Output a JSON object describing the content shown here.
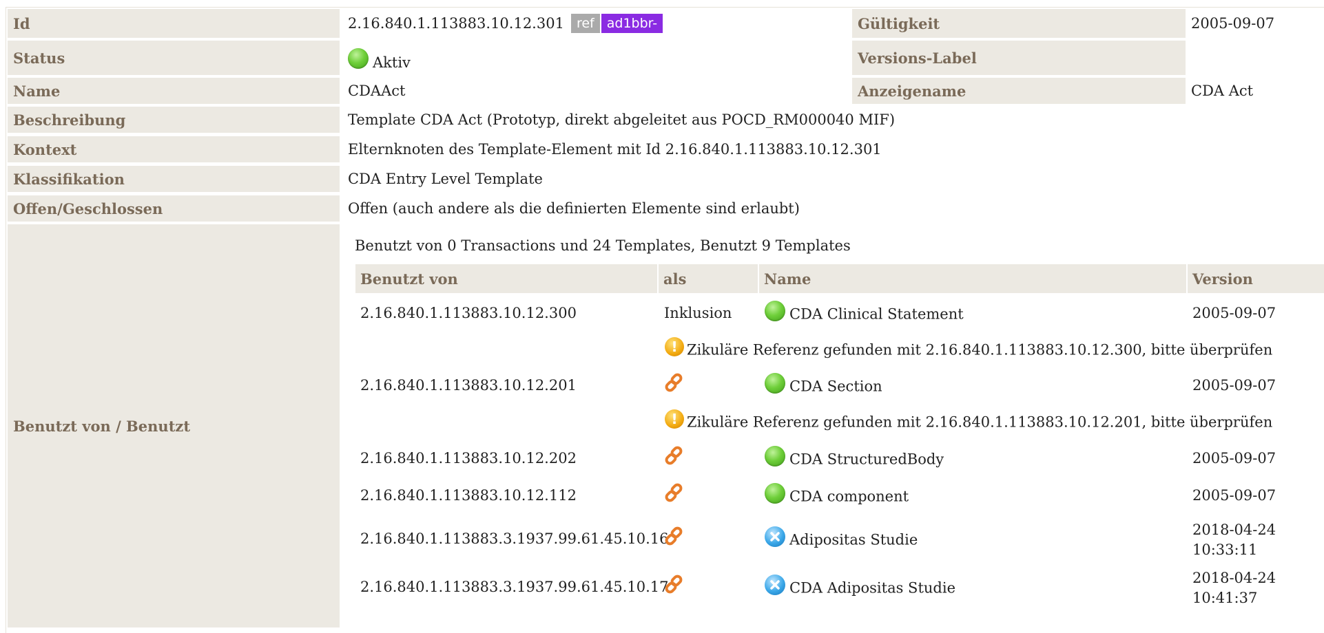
{
  "rows": {
    "id": {
      "label": "Id",
      "value": "2.16.840.1.113883.10.12.301",
      "ref_tag": "ref",
      "id_tag": "ad1bbr-"
    },
    "gueltigkeit": {
      "label": "Gültigkeit",
      "value": "2005-09-07"
    },
    "status": {
      "label": "Status",
      "value": "Aktiv"
    },
    "versions_label": {
      "label": "Versions-Label",
      "value": ""
    },
    "name": {
      "label": "Name",
      "value": "CDAAct"
    },
    "anzeigename": {
      "label": "Anzeigename",
      "value": "CDA Act"
    },
    "beschreibung": {
      "label": "Beschreibung",
      "value": "Template CDA Act (Prototyp, direkt abgeleitet aus POCD_RM000040 MIF)"
    },
    "kontext": {
      "label": "Kontext",
      "value": "Elternknoten des Template-Element mit Id 2.16.840.1.113883.10.12.301"
    },
    "klassifikation": {
      "label": "Klassifikation",
      "value": "CDA Entry Level Template"
    },
    "offen": {
      "label": "Offen/Geschlossen",
      "value": "Offen (auch andere als die definierten Elemente sind erlaubt)"
    },
    "benutzt": {
      "label": "Benutzt von / Benutzt"
    }
  },
  "usage": {
    "summary": "Benutzt von 0 Transactions und 24 Templates, Benutzt 9 Templates",
    "headers": {
      "benutzt_von": "Benutzt von",
      "als": "als",
      "name": "Name",
      "version": "Version"
    },
    "items": [
      {
        "id": "2.16.840.1.113883.10.12.300",
        "als": "Inklusion",
        "status_icon": "green-status-icon",
        "name": "CDA Clinical Statement",
        "version": "2005-09-07",
        "version2": ""
      },
      {
        "warning": "Zikuläre Referenz gefunden mit 2.16.840.1.113883.10.12.300, bitte überprüfen"
      },
      {
        "id": "2.16.840.1.113883.10.12.201",
        "als_icon": "link-icon",
        "status_icon": "green-status-icon",
        "name": "CDA Section",
        "version": "2005-09-07",
        "version2": ""
      },
      {
        "warning": "Zikuläre Referenz gefunden mit 2.16.840.1.113883.10.12.201, bitte überprüfen"
      },
      {
        "id": "2.16.840.1.113883.10.12.202",
        "als_icon": "link-icon",
        "status_icon": "green-status-icon",
        "name": "CDA StructuredBody",
        "version": "2005-09-07",
        "version2": ""
      },
      {
        "id": "2.16.840.1.113883.10.12.112",
        "als_icon": "link-icon",
        "status_icon": "green-status-icon",
        "name": "CDA component",
        "version": "2005-09-07",
        "version2": ""
      },
      {
        "id": "2.16.840.1.113883.3.1937.99.61.45.10.16",
        "als_icon": "link-icon",
        "status_icon": "cancelled-status-icon",
        "name": "Adipositas Studie",
        "version": "2018-04-24",
        "version2": "10:33:11"
      },
      {
        "id": "2.16.840.1.113883.3.1937.99.61.45.10.17",
        "als_icon": "link-icon",
        "status_icon": "cancelled-status-icon",
        "name": "CDA Adipositas Studie",
        "version": "2018-04-24",
        "version2": "10:41:37"
      }
    ]
  },
  "colors": {
    "label_bg": "#ece9e2",
    "label_text": "#7a6a58",
    "id_tag": "#8a2be2",
    "ref_tag": "#aaaaaa",
    "link_icon": "#e87d2a"
  }
}
